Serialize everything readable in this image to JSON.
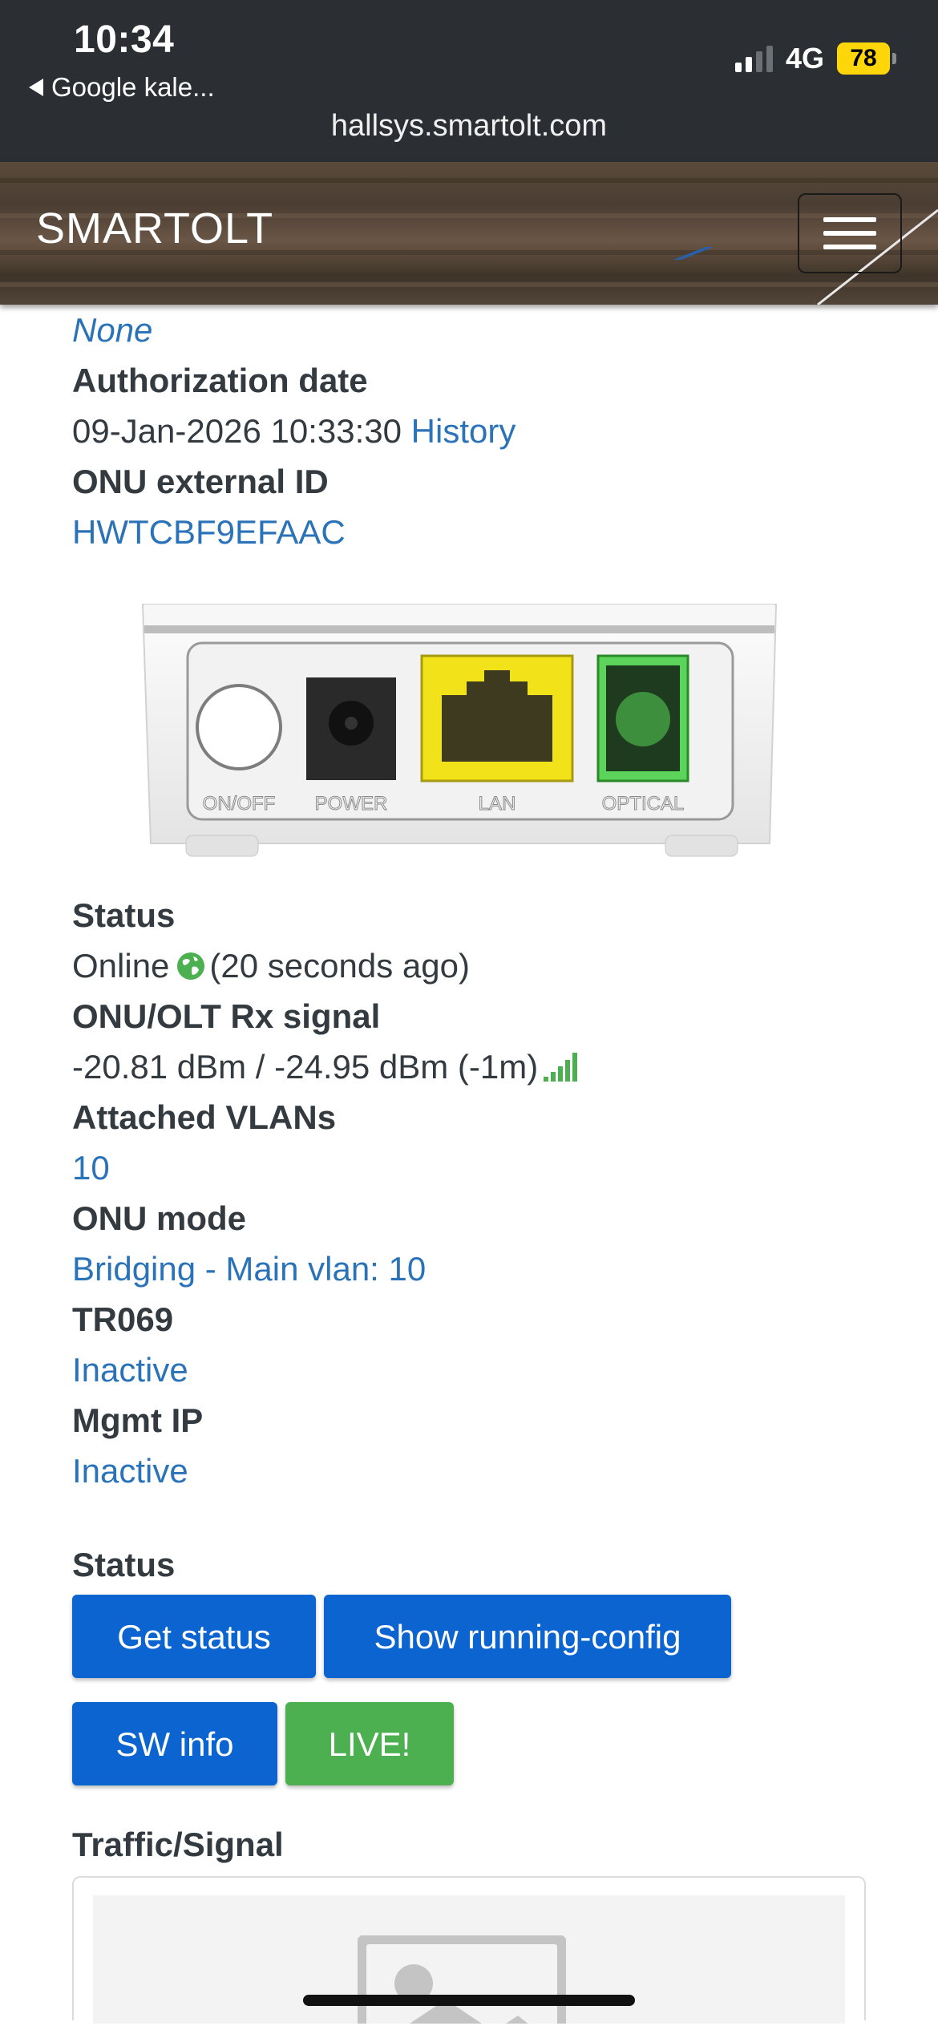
{
  "status_bar": {
    "time": "10:34",
    "back_label": "Google kale...",
    "network": "4G",
    "battery": "78",
    "url": "hallsys.smartolt.com"
  },
  "navbar": {
    "brand": "SMARTOLT"
  },
  "details": {
    "none_value": "None",
    "authorization_date_label": "Authorization date",
    "authorization_date_value": "09-Jan-2026 10:33:30",
    "history_link": "History",
    "external_id_label": "ONU external ID",
    "external_id_value": "HWTCBF9EFAAC",
    "status_label": "Status",
    "status_value": "Online",
    "status_age": "(20 seconds ago)",
    "rx_signal_label": "ONU/OLT Rx signal",
    "rx_signal_value": "-20.81 dBm / -24.95 dBm (-1m)",
    "vlans_label": "Attached VLANs",
    "vlans_value": "10",
    "onu_mode_label": "ONU mode",
    "onu_mode_value": "Bridging - Main vlan: 10",
    "tr069_label": "TR069",
    "tr069_value": "Inactive",
    "mgmt_ip_label": "Mgmt IP",
    "mgmt_ip_value": "Inactive"
  },
  "device_ports": {
    "on_off": "ON/OFF",
    "power": "POWER",
    "lan": "LAN",
    "optical": "OPTICAL"
  },
  "actions": {
    "section_label": "Status",
    "get_status": "Get status",
    "show_running_config": "Show running-config",
    "sw_info": "SW info",
    "live": "LIVE!"
  },
  "traffic": {
    "label": "Traffic/Signal"
  },
  "colors": {
    "link": "#2a73b8",
    "button_blue": "#0b64d0",
    "button_green": "#4caf50",
    "status_online": "#4caf50"
  }
}
